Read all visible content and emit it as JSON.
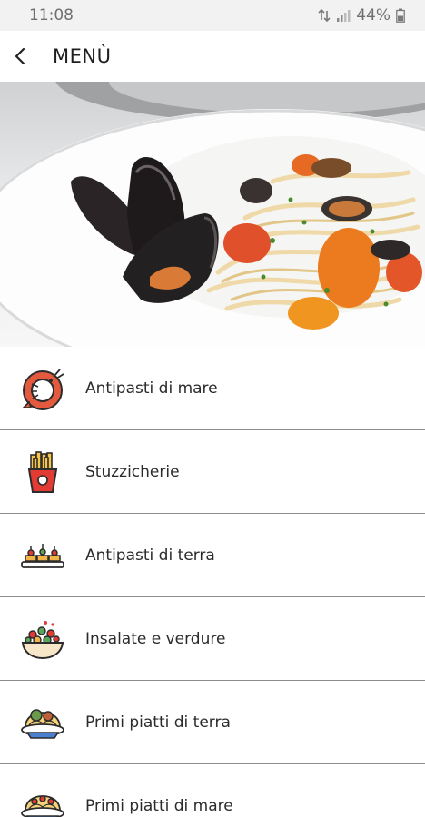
{
  "status_bar": {
    "time": "11:08",
    "battery": "44%"
  },
  "app_bar": {
    "back_icon": "arrow-back-icon",
    "title": "MENÙ"
  },
  "hero": {
    "image": "pasta-with-mussels-and-tomatoes-photo"
  },
  "menu": {
    "items": [
      {
        "label": "Antipasti di mare",
        "icon": "shrimp-icon"
      },
      {
        "label": "Stuzzicherie",
        "icon": "french-fries-icon"
      },
      {
        "label": "Antipasti di terra",
        "icon": "canapes-icon"
      },
      {
        "label": "Insalate e verdure",
        "icon": "salad-bowl-icon"
      },
      {
        "label": "Primi piatti di terra",
        "icon": "spaghetti-meatballs-icon"
      },
      {
        "label": "Primi piatti di mare",
        "icon": "spaghetti-seafood-icon"
      }
    ]
  }
}
